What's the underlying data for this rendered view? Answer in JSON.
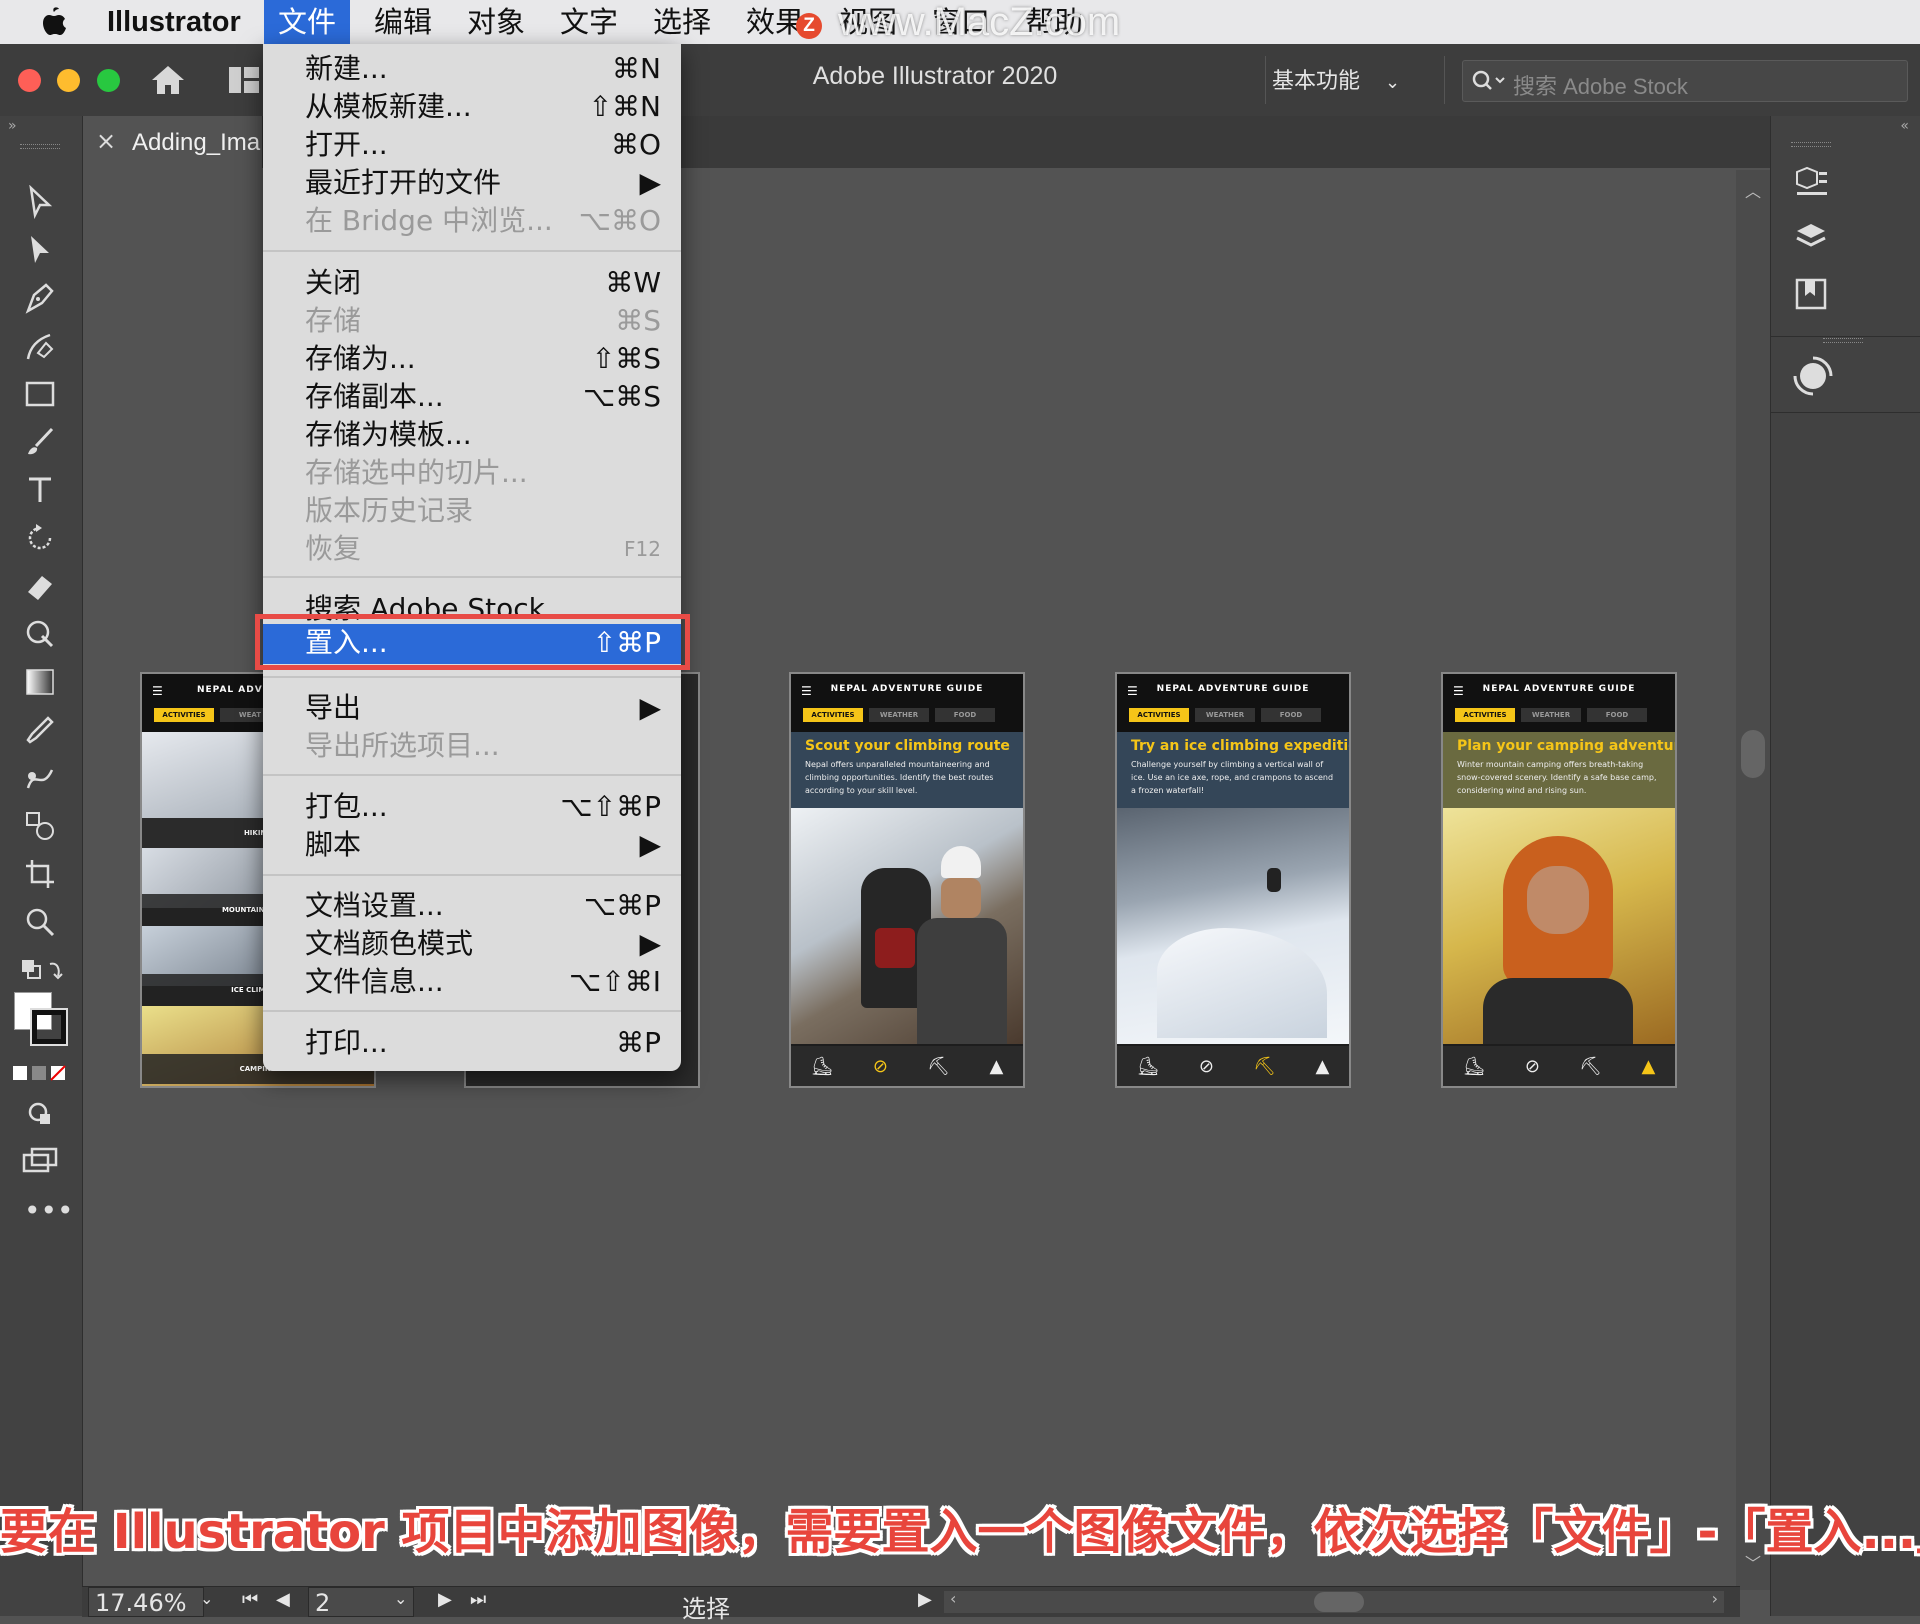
{
  "menubar": {
    "app": "Illustrator",
    "items": [
      "文件",
      "编辑",
      "对象",
      "文字",
      "选择",
      "效果",
      "视图",
      "窗口",
      "帮助"
    ],
    "active": "文件",
    "watermark": "www.MacZ.com",
    "watermark_badge": "Z"
  },
  "window": {
    "title": "Adobe Illustrator 2020",
    "workspace": "基本功能",
    "stock_placeholder": "搜索 Adobe Stock",
    "doc_tab": "Adding_Ima"
  },
  "file_menu": {
    "items": [
      {
        "label": "新建...",
        "shortcut": "⌘N"
      },
      {
        "label": "从模板新建...",
        "shortcut": "⇧⌘N"
      },
      {
        "label": "打开...",
        "shortcut": "⌘O"
      },
      {
        "label": "最近打开的文件",
        "shortcut": "▶"
      },
      {
        "label": "在 Bridge 中浏览...",
        "shortcut": "⌥⌘O"
      },
      {
        "label": "关闭",
        "shortcut": "⌘W"
      },
      {
        "label": "存储",
        "shortcut": "⌘S"
      },
      {
        "label": "存储为...",
        "shortcut": "⇧⌘S"
      },
      {
        "label": "存储副本...",
        "shortcut": "⌥⌘S"
      },
      {
        "label": "存储为模板...",
        "shortcut": ""
      },
      {
        "label": "存储选中的切片...",
        "shortcut": ""
      },
      {
        "label": "版本历史记录",
        "shortcut": ""
      },
      {
        "label": "恢复",
        "shortcut": "F12"
      },
      {
        "label": "搜索 Adobe Stock",
        "shortcut": ""
      },
      {
        "label": "置入...",
        "shortcut": "⇧⌘P"
      },
      {
        "label": "导出",
        "shortcut": "▶"
      },
      {
        "label": "导出所选项目...",
        "shortcut": ""
      },
      {
        "label": "打包...",
        "shortcut": "⌥⇧⌘P"
      },
      {
        "label": "脚本",
        "shortcut": "▶"
      },
      {
        "label": "文档设置...",
        "shortcut": "⌥⌘P"
      },
      {
        "label": "文档颜色模式",
        "shortcut": "▶"
      },
      {
        "label": "文件信息...",
        "shortcut": "⌥⇧⌘I"
      },
      {
        "label": "打印...",
        "shortcut": "⌘P"
      }
    ]
  },
  "artboards": [
    {
      "header": "NEPAL ADVENTURE GUIDE",
      "tabs": [
        "ACTIVITIES",
        "WEATHER",
        "FOOD"
      ],
      "heading_a": "Scout your ",
      "heading_b": "climbing route",
      "body": "Nepal offers unparalleled mountaineering and climbing opportunities. Identify the best routes according to your skill level."
    },
    {
      "header": "NEPAL ADVENTURE GUIDE",
      "tabs": [
        "ACTIVITIES",
        "WEATHER",
        "FOOD"
      ],
      "heading_a": "Try an ",
      "heading_b": "ice climbing expedition",
      "body": "Challenge yourself by climbing a vertical wall of ice. Use an ice axe, rope, and crampons to ascend a frozen waterfall!"
    },
    {
      "header": "NEPAL ADVENTURE GUIDE",
      "tabs": [
        "ACTIVITIES",
        "WEATHER",
        "FOOD"
      ],
      "heading_a": "Plan your ",
      "heading_b": "camping adventure",
      "body": "Winter mountain camping offers breath-taking snow-covered scenery. Identify a safe base camp, considering wind and rising sun."
    }
  ],
  "left_artboard": {
    "header": "NEPAL ADVEN",
    "tabs": [
      "ACTIVITIES",
      "WEAT"
    ],
    "sections": [
      "HIKING",
      "MOUNTAIN CLIMBI",
      "ICE CLIMBING",
      "CAMPING"
    ]
  },
  "caption": "要在 Illustrator 项目中添加图像，需要置入一个图像文件，依次选择「文件」-「置入...」",
  "status": {
    "zoom": "17.46%",
    "artboard": "2",
    "tool": "选择"
  },
  "colors": {
    "highlight": "#2b6ad8",
    "red_box": "#e84b46",
    "accent_yellow": "#f5c518"
  }
}
